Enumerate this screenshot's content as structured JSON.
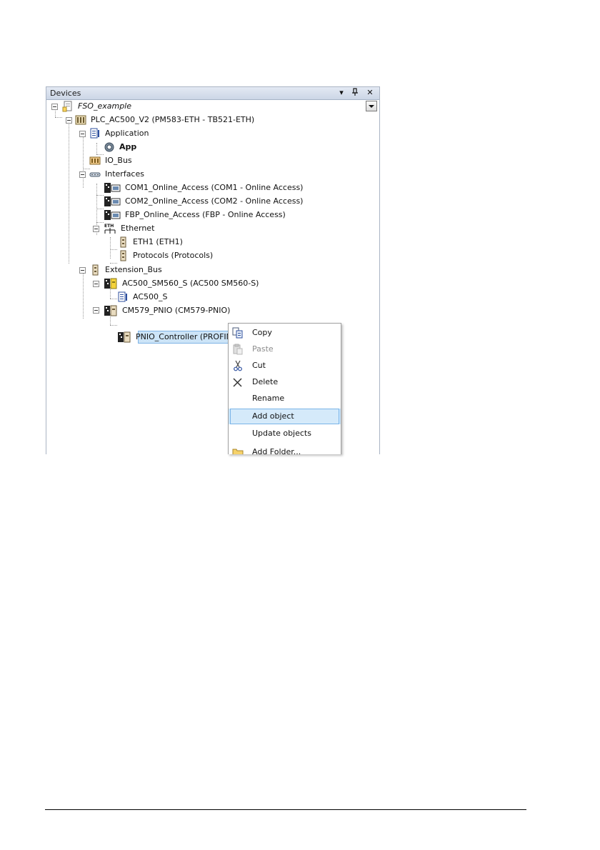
{
  "panel": {
    "title": "Devices",
    "buttons": {
      "dropdown": "▾",
      "pin": "📌",
      "close": "✕"
    }
  },
  "tree": {
    "project": "FSO_example",
    "plc": "PLC_AC500_V2 (PM583-ETH - TB521-ETH)",
    "application": "Application",
    "app": "App",
    "io_bus": "IO_Bus",
    "interfaces": "Interfaces",
    "com1": "COM1_Online_Access (COM1 - Online Access)",
    "com2": "COM2_Online_Access (COM2 - Online Access)",
    "fbp": "FBP_Online_Access (FBP - Online Access)",
    "ethernet": "Ethernet",
    "eth1": "ETH1 (ETH1)",
    "protocols": "Protocols (Protocols)",
    "extension_bus": "Extension_Bus",
    "sm560": "AC500_SM560_S (AC500 SM560-S)",
    "ac500_s": "AC500_S",
    "cm579": "CM579_PNIO (CM579-PNIO)",
    "pnio_controller": "PNIO_Controller (PROFINET IO Controller)"
  },
  "context_menu": {
    "items": [
      {
        "label": "Copy",
        "icon": "copy-icon",
        "enabled": true
      },
      {
        "label": "Paste",
        "icon": "paste-icon",
        "enabled": false
      },
      {
        "label": "Cut",
        "icon": "scissors-icon",
        "enabled": true
      },
      {
        "label": "Delete",
        "icon": "delete-x-icon",
        "enabled": true
      },
      {
        "label": "Rename",
        "icon": "",
        "enabled": true
      },
      {
        "label": "Add object",
        "icon": "",
        "enabled": true,
        "highlighted": true
      },
      {
        "label": "Update objects",
        "icon": "",
        "enabled": true
      },
      {
        "label": "Add Folder...",
        "icon": "folder-icon",
        "enabled": true
      }
    ]
  },
  "colors": {
    "selection": "#cce4f7",
    "menu_highlight": "#cce8ff",
    "header": "#d6dfed"
  }
}
